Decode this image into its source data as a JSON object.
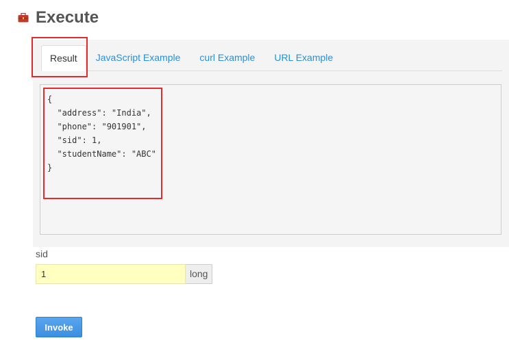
{
  "header": {
    "title": "Execute",
    "icon": "toolbox-icon"
  },
  "tabs": [
    {
      "label": "Result",
      "active": true
    },
    {
      "label": "JavaScript Example"
    },
    {
      "label": "curl Example"
    },
    {
      "label": "URL Example"
    }
  ],
  "result": {
    "lines": [
      "{",
      "  \"address\": \"India\",",
      "  \"phone\": \"901901\",",
      "  \"sid\": 1,",
      "  \"studentName\": \"ABC\"",
      "}"
    ]
  },
  "param": {
    "label": "sid",
    "value": "1",
    "type": "long"
  },
  "invoke": {
    "label": "Invoke"
  },
  "colors": {
    "accent": "#2a8fd4",
    "highlight": "#e32b2b",
    "input_bg": "#ffffc0",
    "button": "#4a9be8"
  }
}
